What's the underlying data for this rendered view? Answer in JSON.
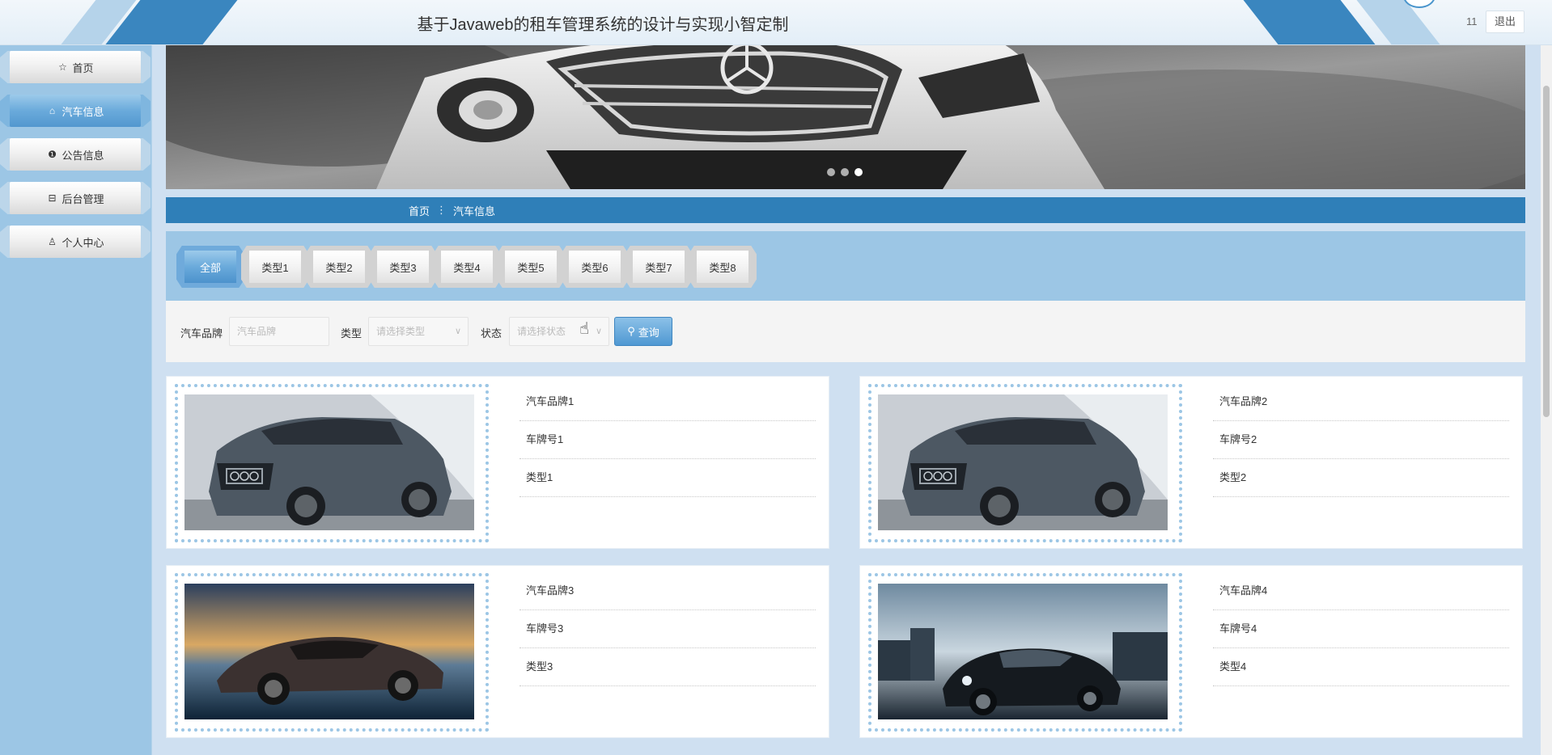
{
  "header": {
    "title": "基于Javaweb的租车管理系统的设计与实现小智定制",
    "user": "11",
    "logout_label": "退出"
  },
  "sidebar": {
    "items": [
      {
        "label": "首页",
        "icon": "star-icon"
      },
      {
        "label": "汽车信息",
        "icon": "home-icon"
      },
      {
        "label": "公告信息",
        "icon": "info-circle-icon"
      },
      {
        "label": "后台管理",
        "icon": "bag-icon"
      },
      {
        "label": "个人中心",
        "icon": "user-icon"
      }
    ],
    "active_index": 1
  },
  "banner": {
    "slides": 3,
    "active_slide": 3
  },
  "breadcrumb": {
    "home": "首页",
    "separator": "⋮",
    "current": "汽车信息"
  },
  "types": {
    "items": [
      "全部",
      "类型1",
      "类型2",
      "类型3",
      "类型4",
      "类型5",
      "类型6",
      "类型7",
      "类型8"
    ],
    "active_index": 0
  },
  "search": {
    "brand_label": "汽车品牌",
    "brand_placeholder": "汽车品牌",
    "type_label": "类型",
    "type_placeholder": "请选择类型",
    "status_label": "状态",
    "status_placeholder": "请选择状态",
    "button_label": "查询"
  },
  "cars": [
    {
      "brand": "汽车品牌1",
      "plate": "车牌号1",
      "type": "类型1"
    },
    {
      "brand": "汽车品牌2",
      "plate": "车牌号2",
      "type": "类型2"
    },
    {
      "brand": "汽车品牌3",
      "plate": "车牌号3",
      "type": "类型3"
    },
    {
      "brand": "汽车品牌4",
      "plate": "车牌号4",
      "type": "类型4"
    }
  ],
  "colors": {
    "primary": "#2f7fb8",
    "light_blue": "#9cc6e5",
    "accent": "#4f98d2"
  }
}
